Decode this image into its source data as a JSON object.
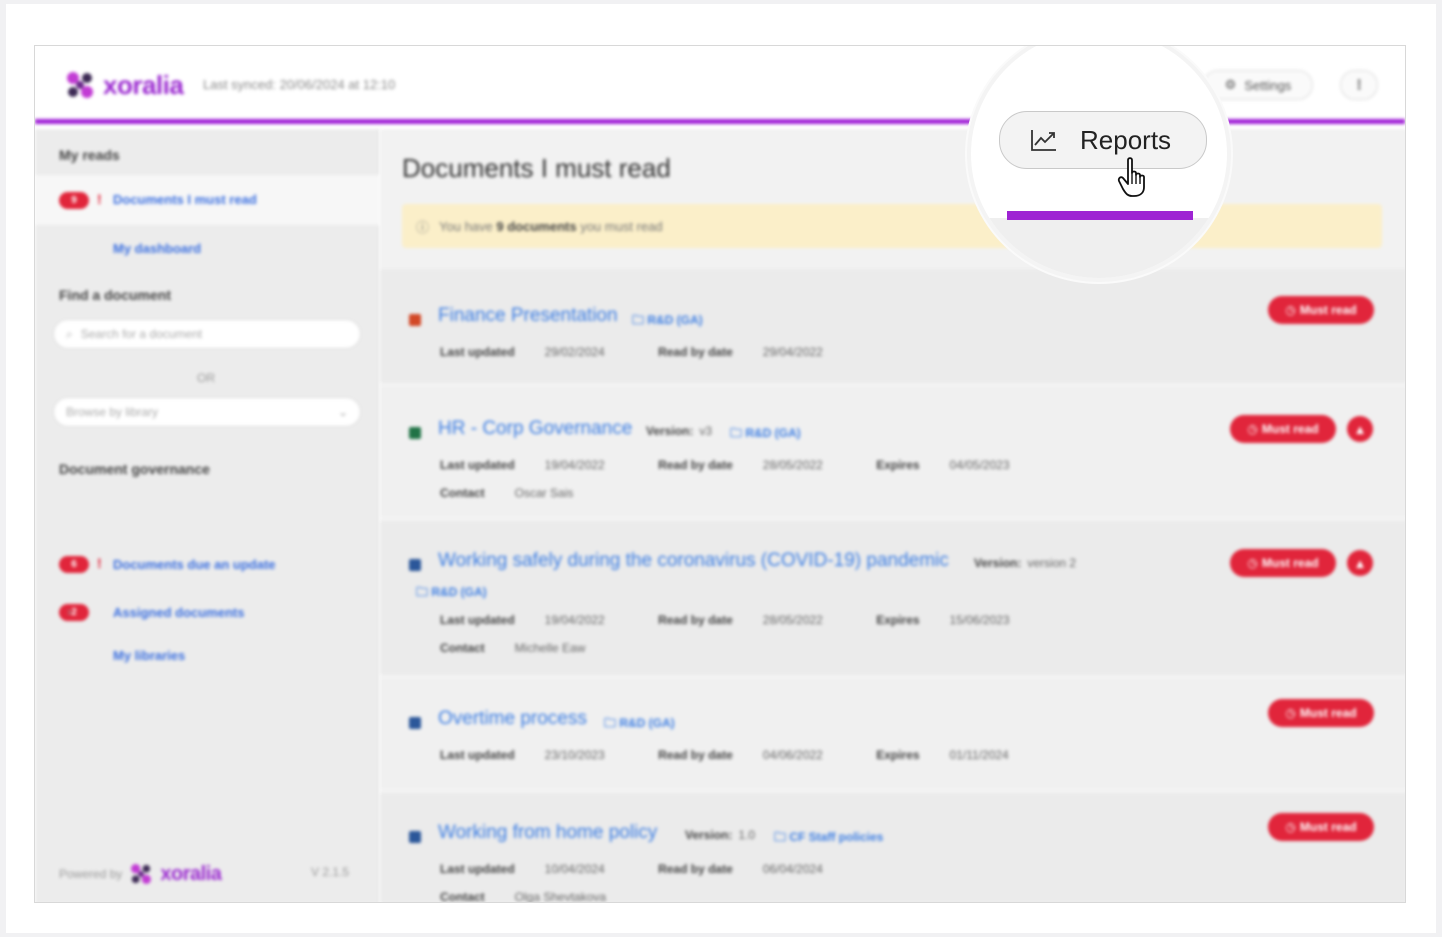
{
  "app": {
    "brand": "xoralia",
    "last_synced": "Last synced: 20/06/2024 at 12:10",
    "settings_label": "Settings",
    "more_label": "⋮",
    "reports_label": "Reports",
    "accent_color": "#a020d6",
    "danger_color": "#e1253b",
    "link_color": "#3b7de3"
  },
  "sidebar": {
    "my_reads_heading": "My reads",
    "must_read_badge": "9",
    "must_read_link": "Documents I must read",
    "dashboard_link": "My dashboard",
    "find_heading": "Find a document",
    "search_placeholder": "Search for a document",
    "or_text": "OR",
    "browse_placeholder": "Browse by library",
    "governance_heading": "Document governance",
    "update_badge": "6",
    "update_link": "Documents due an update",
    "assigned_badge": "2",
    "assigned_link": "Assigned documents",
    "libraries_link": "My libraries",
    "powered_by": "Powered by",
    "version": "V 2.1.5"
  },
  "main": {
    "title": "Documents I must read",
    "notice_prefix": "You have",
    "notice_count": "9 documents",
    "notice_suffix": "you must read",
    "must_read_label": "Must read",
    "documents": [
      {
        "title": "Finance Presentation",
        "folder": "R&D (GA)",
        "last_updated_label": "Last updated",
        "last_updated": "29/02/2024",
        "read_by_label": "Read by date",
        "read_by": "29/04/2022",
        "icon": "powerpoint-icon"
      },
      {
        "title": "HR - Corp Governance",
        "version_label": "Version:",
        "version": "v3",
        "folder": "R&D (GA)",
        "last_updated_label": "Last updated",
        "last_updated": "19/04/2022",
        "read_by_label": "Read by date",
        "read_by": "28/05/2022",
        "expires_label": "Expires",
        "expires": "04/05/2023",
        "contact_label": "Contact",
        "contact": "Oscar Sais",
        "icon": "excel-icon"
      },
      {
        "title": "Working safely during the coronavirus (COVID-19) pandemic",
        "version_label": "Version:",
        "version": "version 2",
        "folder": "R&D (GA)",
        "last_updated_label": "Last updated",
        "last_updated": "19/04/2022",
        "read_by_label": "Read by date",
        "read_by": "28/05/2022",
        "expires_label": "Expires",
        "expires": "15/06/2023",
        "contact_label": "Contact",
        "contact": "Michelle Eaw",
        "icon": "word-icon"
      },
      {
        "title": "Overtime process",
        "folder": "R&D (GA)",
        "last_updated_label": "Last updated",
        "last_updated": "23/10/2023",
        "read_by_label": "Read by date",
        "read_by": "04/06/2022",
        "expires_label": "Expires",
        "expires": "01/11/2024",
        "icon": "word-icon"
      },
      {
        "title": "Working from home policy",
        "version_label": "Version:",
        "version": "1.0",
        "folder": "CF Staff policies",
        "last_updated_label": "Last updated",
        "last_updated": "10/04/2024",
        "read_by_label": "Read by date",
        "read_by": "06/04/2024",
        "contact_label": "Contact",
        "contact": "Olga Shevtakova",
        "icon": "word-icon"
      }
    ]
  }
}
